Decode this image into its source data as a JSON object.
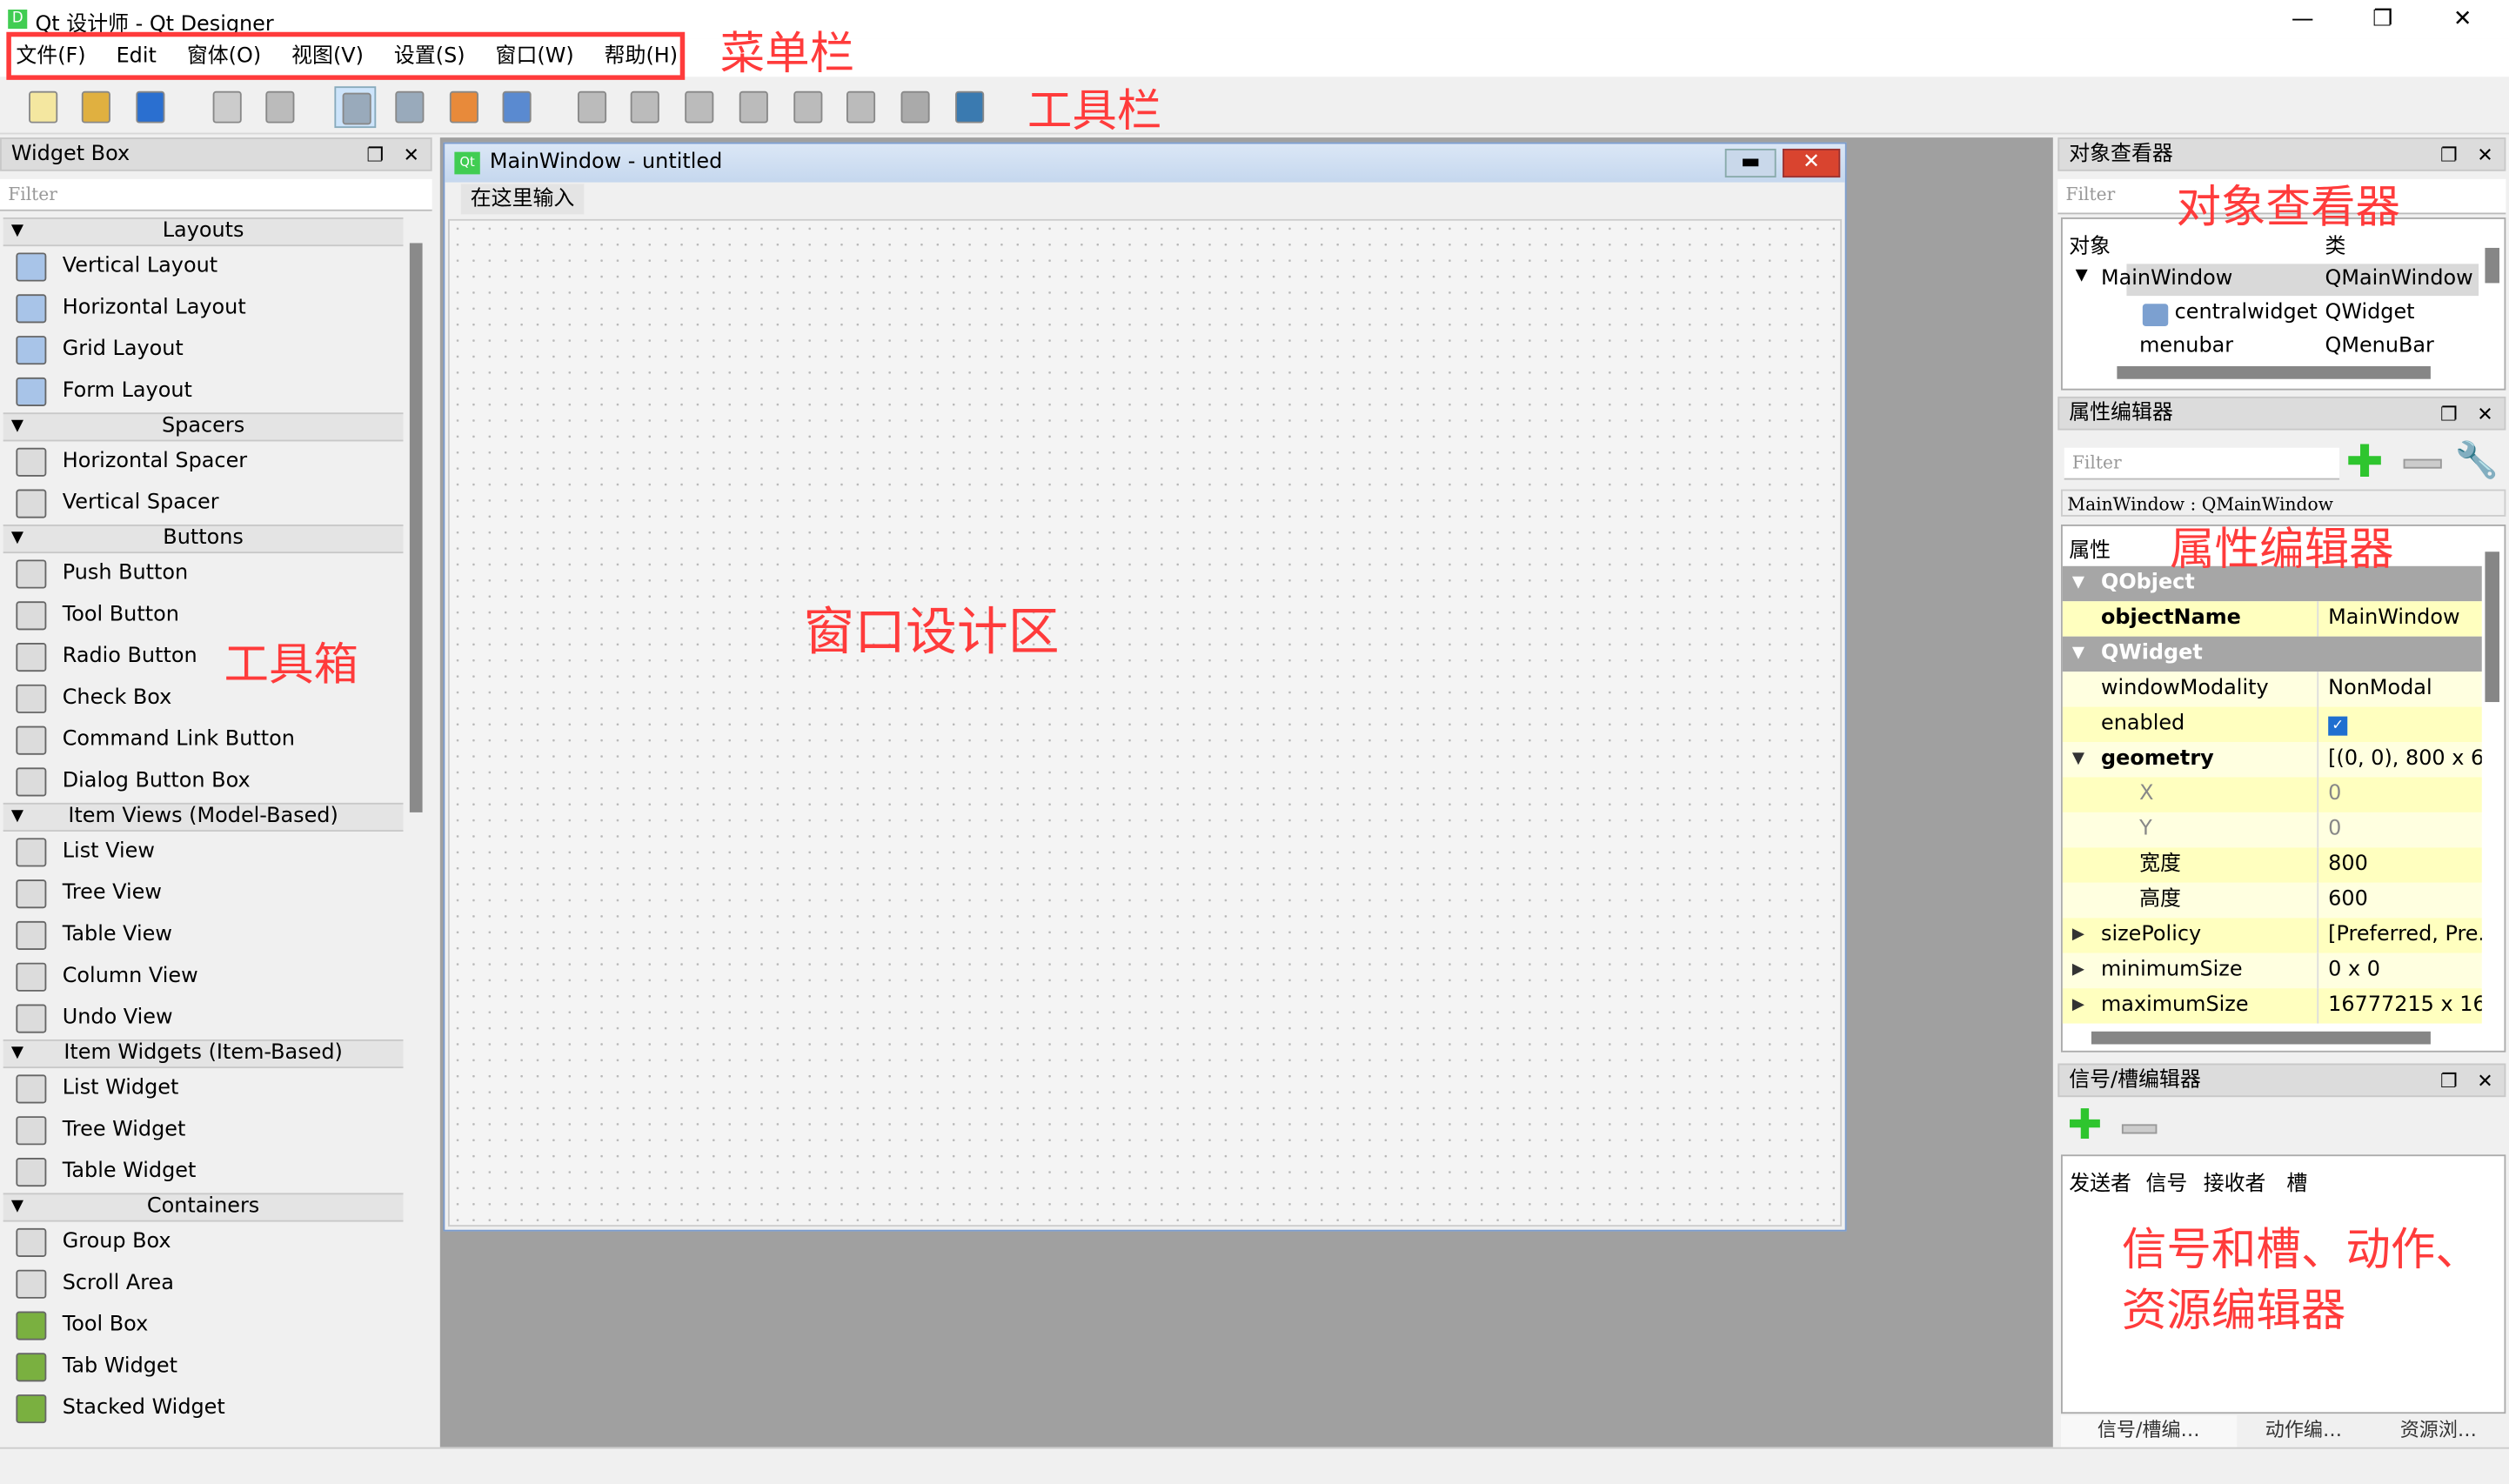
{
  "window": {
    "title": "Qt 设计师 - Qt Designer",
    "logo": "D",
    "minimize": "—",
    "maximize": "❐",
    "close": "✕"
  },
  "menu": [
    "文件(F)",
    "Edit",
    "窗体(O)",
    "视图(V)",
    "设置(S)",
    "窗口(W)",
    "帮助(H)"
  ],
  "annotations": {
    "menubar": "菜单栏",
    "toolbar": "工具栏",
    "toolbox": "工具箱",
    "design_area": "窗口设计区",
    "object_inspector": "对象查看器",
    "property_editor": "属性编辑器",
    "signal_editor_line1": "信号和槽、动作、",
    "signal_editor_line2": "资源编辑器"
  },
  "annotation_color": "#ff3b3b",
  "toolbar_icons": [
    "new-file",
    "open-folder",
    "save",
    "send-to-back",
    "bring-to-front",
    "edit-widgets",
    "edit-signals-slots",
    "edit-buddies",
    "edit-tab-order",
    "layout-horizontal",
    "layout-vertical",
    "layout-horizontal-splitter",
    "layout-vertical-splitter",
    "layout-grid",
    "layout-form",
    "break-layout",
    "adjust-size"
  ],
  "widget_box": {
    "title": "Widget Box",
    "filter_placeholder": "Filter",
    "sections": [
      {
        "name": "Layouts",
        "items": [
          "Vertical Layout",
          "Horizontal Layout",
          "Grid Layout",
          "Form Layout"
        ]
      },
      {
        "name": "Spacers",
        "items": [
          "Horizontal Spacer",
          "Vertical Spacer"
        ]
      },
      {
        "name": "Buttons",
        "items": [
          "Push Button",
          "Tool Button",
          "Radio Button",
          "Check Box",
          "Command Link Button",
          "Dialog Button Box"
        ]
      },
      {
        "name": "Item Views (Model-Based)",
        "items": [
          "List View",
          "Tree View",
          "Table View",
          "Column View",
          "Undo View"
        ]
      },
      {
        "name": "Item Widgets (Item-Based)",
        "items": [
          "List Widget",
          "Tree Widget",
          "Table Widget"
        ]
      },
      {
        "name": "Containers",
        "items": [
          "Group Box",
          "Scroll Area",
          "Tool Box",
          "Tab Widget",
          "Stacked Widget"
        ]
      }
    ]
  },
  "form": {
    "title": "MainWindow - untitled",
    "menu_placeholder": "在这里输入"
  },
  "object_inspector": {
    "title": "对象查看器",
    "filter_placeholder": "Filter",
    "columns": [
      "对象",
      "类"
    ],
    "rows": [
      {
        "object": "MainWindow",
        "class": "QMainWindow"
      },
      {
        "object": "centralwidget",
        "class": "QWidget"
      },
      {
        "object": "menubar",
        "class": "QMenuBar"
      }
    ]
  },
  "property_editor": {
    "title": "属性编辑器",
    "filter_placeholder": "Filter",
    "context": "MainWindow : QMainWindow",
    "column": "属性",
    "rows": [
      {
        "type": "group",
        "name": "QObject"
      },
      {
        "type": "prop",
        "name": "objectName",
        "value": "MainWindow",
        "bold": true
      },
      {
        "type": "group",
        "name": "QWidget"
      },
      {
        "type": "prop",
        "name": "windowModality",
        "value": "NonModal"
      },
      {
        "type": "check",
        "name": "enabled",
        "value": true
      },
      {
        "type": "prop",
        "name": "geometry",
        "value": "[(0, 0), 800 x 6...",
        "bold": true,
        "expand": "open"
      },
      {
        "type": "sub",
        "name": "X",
        "value": "0"
      },
      {
        "type": "sub",
        "name": "Y",
        "value": "0"
      },
      {
        "type": "sub",
        "name": "宽度",
        "value": "800"
      },
      {
        "type": "sub",
        "name": "高度",
        "value": "600"
      },
      {
        "type": "prop",
        "name": "sizePolicy",
        "value": "[Preferred, Pre...",
        "expand": "closed"
      },
      {
        "type": "prop",
        "name": "minimumSize",
        "value": "0 x 0",
        "expand": "closed"
      },
      {
        "type": "prop",
        "name": "maximumSize",
        "value": "16777215 x 16...",
        "expand": "closed"
      }
    ]
  },
  "signal_editor": {
    "title": "信号/槽编辑器",
    "columns": [
      "发送者",
      "信号",
      "接收者",
      "槽"
    ],
    "tabs": [
      "信号/槽编…",
      "动作编…",
      "资源浏…"
    ]
  }
}
